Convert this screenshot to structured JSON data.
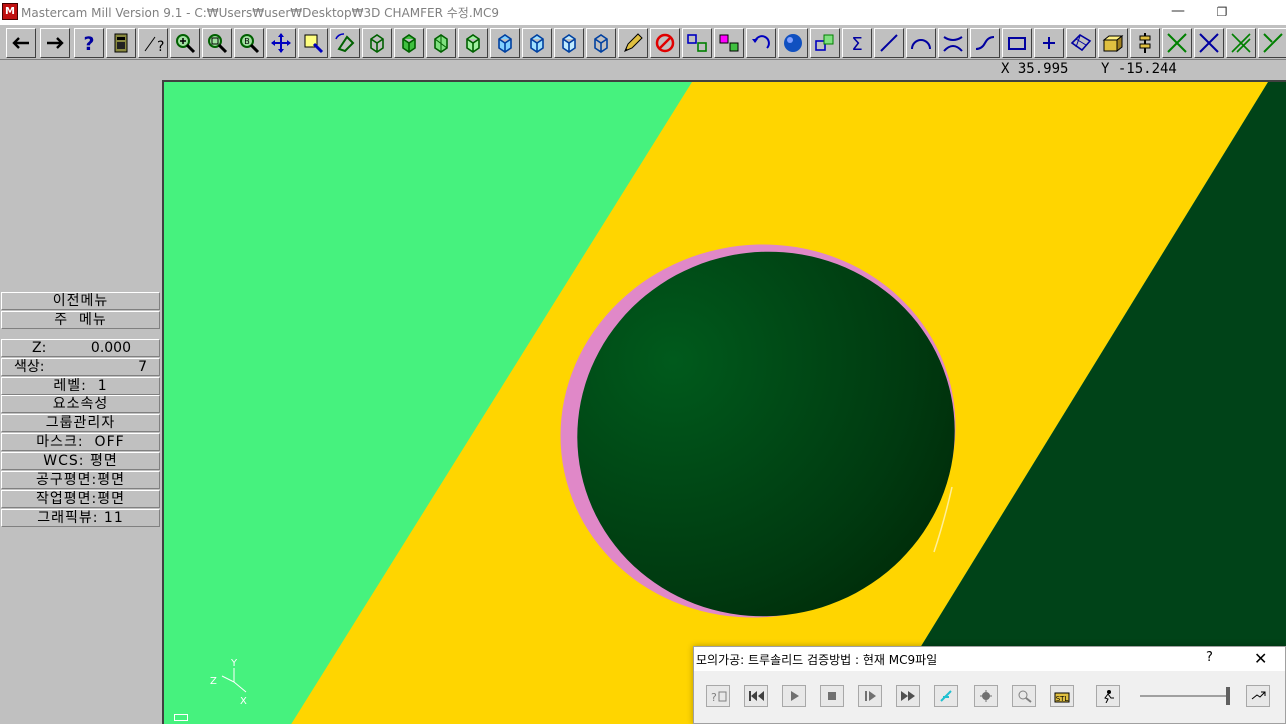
{
  "window": {
    "app_icon_text": "M",
    "title": "Mastercam Mill Version 9.1 - C:₩Users₩user₩Desktop₩3D CHAMFER 수정.MC9",
    "minimize_glyph": "—",
    "restore_glyph": "❐"
  },
  "toolbar": {
    "buttons": [
      {
        "name": "back-arrow-icon"
      },
      {
        "name": "forward-arrow-icon"
      },
      {
        "name": "help-icon",
        "glyph": "?"
      },
      {
        "name": "calculator-icon"
      },
      {
        "name": "analyze-icon"
      },
      {
        "name": "zoom-in-icon"
      },
      {
        "name": "zoom-window-icon"
      },
      {
        "name": "zoom-fit-icon"
      },
      {
        "name": "pan-icon"
      },
      {
        "name": "zoom-select-icon"
      },
      {
        "name": "rotate-view-icon"
      },
      {
        "name": "view-top-icon"
      },
      {
        "name": "view-front-icon"
      },
      {
        "name": "view-side-icon"
      },
      {
        "name": "view-iso-icon"
      },
      {
        "name": "cplane-top-icon"
      },
      {
        "name": "cplane-front-icon"
      },
      {
        "name": "cplane-side-icon"
      },
      {
        "name": "cplane-iso-icon"
      },
      {
        "name": "pencil-icon"
      },
      {
        "name": "delete-icon"
      },
      {
        "name": "move-icon"
      },
      {
        "name": "copy-icon"
      },
      {
        "name": "undo-icon"
      },
      {
        "name": "shade-sphere-icon"
      },
      {
        "name": "transform-icon"
      },
      {
        "name": "sigma-icon"
      },
      {
        "name": "line-icon"
      },
      {
        "name": "arc-icon"
      },
      {
        "name": "fillet-icon"
      },
      {
        "name": "spline-icon"
      },
      {
        "name": "rectangle-icon"
      },
      {
        "name": "point-icon"
      },
      {
        "name": "surface-icon"
      },
      {
        "name": "solid-box-icon"
      },
      {
        "name": "toolpath-icon"
      },
      {
        "name": "trim-icon"
      },
      {
        "name": "trim-two-icon"
      },
      {
        "name": "trim-three-icon"
      },
      {
        "name": "break-icon"
      }
    ]
  },
  "coords": {
    "x_text": "X 35.995",
    "y_text": "Y -15.244"
  },
  "menu": {
    "prev_menu": "이전메뉴",
    "main_menu": "주  메뉴",
    "z_label": "Z:",
    "z_value": "0.000",
    "color_label": "색상:",
    "color_value": "7",
    "level_text": "레벨:  1",
    "attributes": "요소속성",
    "group_manager": "그룹관리자",
    "mask_text": "마스크:  OFF",
    "wcs_text": "WCS: 평면",
    "tool_plane": "공구평면:평면",
    "work_plane": "작업평면:평면",
    "graphic_view": "그래픽뷰: 11"
  },
  "viewport": {
    "colors": {
      "background": "#46f27e",
      "face": "#ffd500",
      "dark_face": "#004318",
      "hole": "#003a10",
      "chamfer": "#e088c8"
    },
    "axis_y": "Y",
    "axis_z": "Z",
    "axis_x": "X"
  },
  "verify": {
    "title": "모의가공: 트루솔리드 검증방법 : 현재 MC9파일",
    "help": "?",
    "close": "✕",
    "buttons": [
      {
        "name": "options-icon"
      },
      {
        "name": "rewind-icon"
      },
      {
        "name": "play-icon"
      },
      {
        "name": "stop-icon"
      },
      {
        "name": "step-icon"
      },
      {
        "name": "fast-forward-icon"
      },
      {
        "name": "tool-display-icon"
      },
      {
        "name": "collision-icon"
      },
      {
        "name": "compare-icon"
      },
      {
        "name": "stl-save-icon"
      },
      {
        "name": "run-speed-icon"
      },
      {
        "name": "max-speed-icon"
      }
    ],
    "speed_level": 1.0
  }
}
